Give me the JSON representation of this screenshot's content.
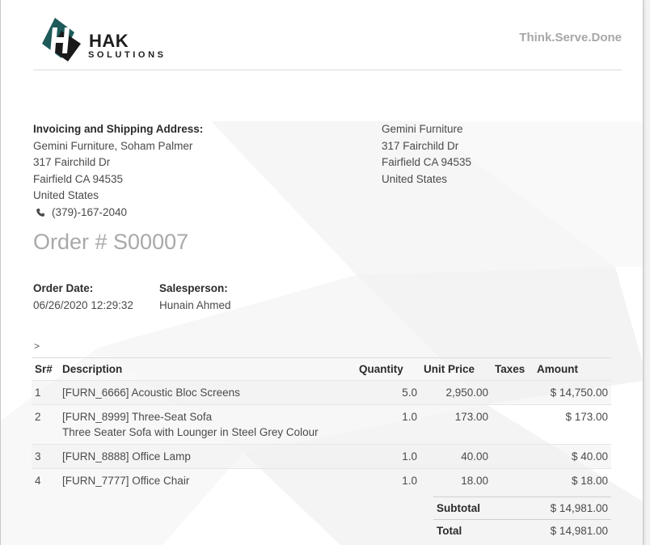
{
  "brand": {
    "name": "HAK",
    "sub": "SOLUTIONS",
    "tagline": "Think.Serve.Done",
    "colors": {
      "teal": "#1e5a5a",
      "dark": "#1d1d1d"
    }
  },
  "invoice_address": {
    "heading": "Invoicing and Shipping Address:",
    "lines": [
      "Gemini Furniture, Soham Palmer",
      "317 Fairchild Dr",
      "Fairfield CA 94535",
      "United States"
    ],
    "phone": "(379)-167-2040"
  },
  "company_address": {
    "lines": [
      "Gemini Furniture",
      "317 Fairchild Dr",
      "Fairfield CA 94535",
      "United States"
    ]
  },
  "order": {
    "title": "Order # S00007",
    "date_label": "Order Date:",
    "date_value": "06/26/2020 12:29:32",
    "salesperson_label": "Salesperson:",
    "salesperson_value": "Hunain Ahmed"
  },
  "caret": ">",
  "table": {
    "headers": {
      "sr": "Sr#",
      "description": "Description",
      "quantity": "Quantity",
      "unit_price": "Unit Price",
      "taxes": "Taxes",
      "amount": "Amount"
    },
    "rows": [
      {
        "sr": "1",
        "desc": "[FURN_6666] Acoustic Bloc Screens",
        "desc2": "",
        "qty": "5.0",
        "price": "2,950.00",
        "taxes": "",
        "amount": "$ 14,750.00"
      },
      {
        "sr": "2",
        "desc": "[FURN_8999] Three-Seat Sofa",
        "desc2": "Three Seater Sofa with Lounger in Steel Grey Colour",
        "qty": "1.0",
        "price": "173.00",
        "taxes": "",
        "amount": "$ 173.00"
      },
      {
        "sr": "3",
        "desc": "[FURN_8888] Office Lamp",
        "desc2": "",
        "qty": "1.0",
        "price": "40.00",
        "taxes": "",
        "amount": "$ 40.00"
      },
      {
        "sr": "4",
        "desc": "[FURN_7777] Office Chair",
        "desc2": "",
        "qty": "1.0",
        "price": "18.00",
        "taxes": "",
        "amount": "$ 18.00"
      }
    ]
  },
  "totals": {
    "subtotal_label": "Subtotal",
    "subtotal_value": "$ 14,981.00",
    "total_label": "Total",
    "total_value": "$ 14,981.00"
  },
  "icons": {
    "phone": "phone-icon",
    "logo": "hak-logo-icon"
  }
}
